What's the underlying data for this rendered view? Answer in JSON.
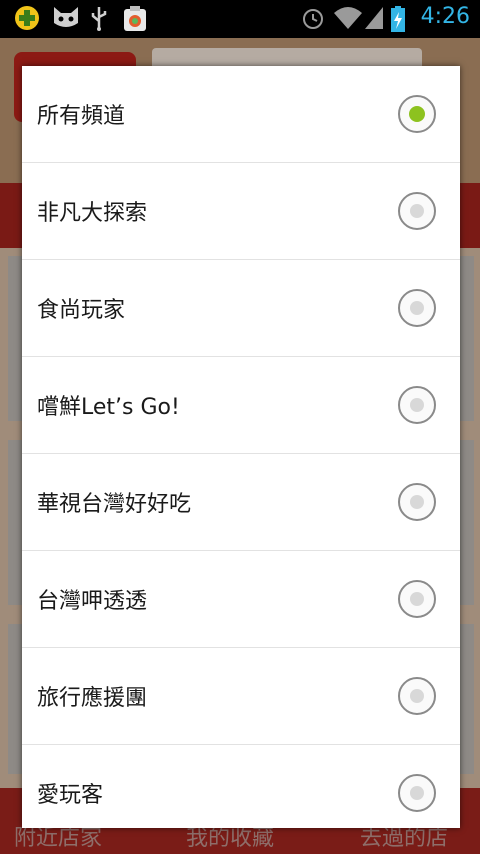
{
  "status_bar": {
    "time": "4:26",
    "icons": [
      "plus-circle-icon",
      "cat-mask-icon",
      "usb-icon",
      "app-shield-icon",
      "alarm-icon",
      "wifi-icon",
      "signal-icon",
      "battery-charging-icon"
    ]
  },
  "background": {
    "bottom_tabs": [
      "附近店家",
      "我的收藏",
      "去過的店"
    ]
  },
  "dialog": {
    "options": [
      {
        "label": "所有頻道",
        "selected": true
      },
      {
        "label": "非凡大探索",
        "selected": false
      },
      {
        "label": "食尚玩家",
        "selected": false
      },
      {
        "label": "嚐鮮Let’s Go!",
        "selected": false
      },
      {
        "label": "華視台灣好好吃",
        "selected": false
      },
      {
        "label": "台灣呷透透",
        "selected": false
      },
      {
        "label": "旅行應援團",
        "selected": false
      },
      {
        "label": "愛玩客",
        "selected": false
      }
    ]
  },
  "colors": {
    "accent_selected": "#8dc21f",
    "status_time": "#33b5e5"
  }
}
